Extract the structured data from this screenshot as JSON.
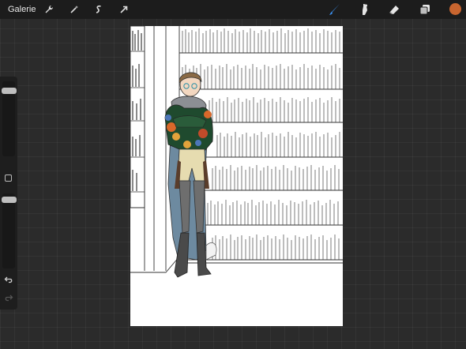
{
  "toolbar": {
    "gallery_label": "Galerie",
    "left_tools": [
      {
        "icon": "wrench-icon"
      },
      {
        "icon": "magic-wand-icon"
      },
      {
        "icon": "selection-icon"
      },
      {
        "icon": "transform-arrow-icon"
      }
    ],
    "right_tools": [
      {
        "icon": "brush-icon",
        "active": true
      },
      {
        "icon": "smudge-icon"
      },
      {
        "icon": "eraser-icon"
      },
      {
        "icon": "layers-icon"
      }
    ],
    "current_color": "#c8652f"
  },
  "sidebar": {
    "brush_size_slider": {
      "icon": "size-slider"
    },
    "modify_button": {
      "icon": "square-icon"
    },
    "opacity_slider": {
      "icon": "opacity-slider"
    },
    "undo": {
      "icon": "undo-icon"
    },
    "redo": {
      "icon": "redo-icon"
    }
  },
  "colors": {
    "active_tool": "#3a8ff0",
    "canvas_bg": "#ffffff",
    "app_bg": "#2b2b2b"
  }
}
